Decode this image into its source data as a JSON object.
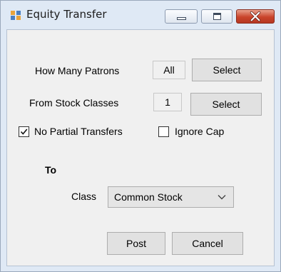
{
  "window": {
    "title": "Equity Transfer",
    "icons": {
      "app": "window-app-icon",
      "minimize": "minimize-icon",
      "maximize": "maximize-icon",
      "close": "close-icon"
    }
  },
  "form": {
    "patrons_label": "How Many Patrons",
    "patrons_value": "All",
    "patrons_select_label": "Select",
    "stock_classes_label": "From Stock Classes",
    "stock_classes_value": "1",
    "stock_classes_select_label": "Select",
    "no_partial_label": "No Partial Transfers",
    "no_partial_checked": true,
    "ignore_cap_label": "Ignore Cap",
    "ignore_cap_checked": false,
    "to_heading": "To",
    "class_label": "Class",
    "class_value": "Common Stock",
    "post_label": "Post",
    "cancel_label": "Cancel"
  },
  "colors": {
    "close_button": "#c9442b",
    "client_bg": "#f0f0f0",
    "frame_bg": "#dfe9f5"
  }
}
